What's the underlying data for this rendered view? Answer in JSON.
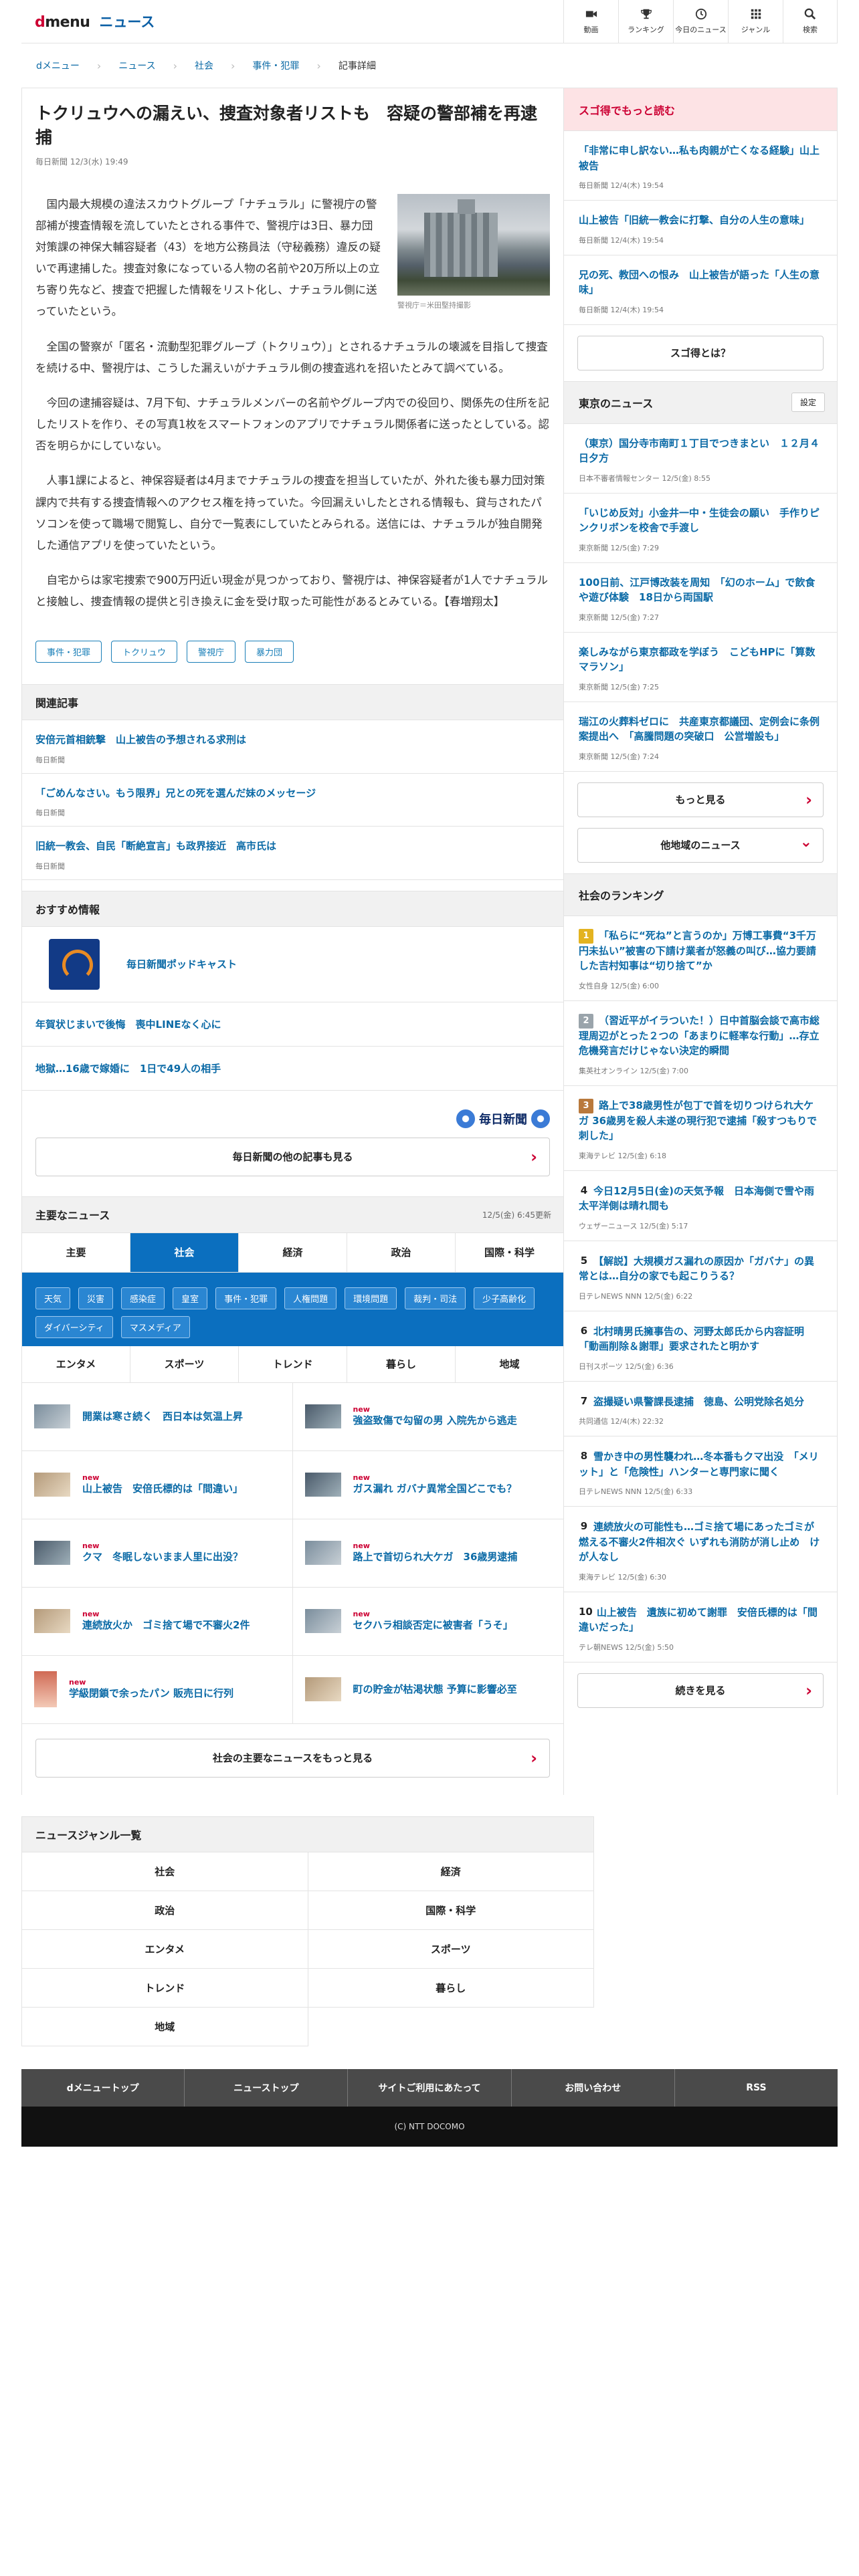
{
  "header": {
    "logo_d": "d",
    "logo_menu": "menu",
    "logo_news": "ニュース",
    "nav": [
      {
        "label": "動画",
        "icon": "video-icon"
      },
      {
        "label": "ランキング",
        "icon": "trophy-icon"
      },
      {
        "label": "今日のニュース",
        "icon": "clock-icon"
      },
      {
        "label": "ジャンル",
        "icon": "grid-icon"
      },
      {
        "label": "検索",
        "icon": "search-icon"
      }
    ]
  },
  "breadcrumb": [
    "dメニュー",
    "ニュース",
    "社会",
    "事件・犯罪",
    "記事詳細"
  ],
  "article": {
    "title": "トクリュウへの漏えい、捜査対象者リストも　容疑の警部補を再逮捕",
    "meta": "毎日新聞 12/3(水) 19:49",
    "image_caption": "警視庁＝米田堅持撮影",
    "paragraphs": [
      "国内最大規模の違法スカウトグループ「ナチュラル」に警視庁の警部補が捜査情報を流していたとされる事件で、警視庁は3日、暴力団対策課の神保大輔容疑者（43）を地方公務員法（守秘義務）違反の疑いで再逮捕した。捜査対象になっている人物の名前や20万所以上の立ち寄り先など、捜査で把握した情報をリスト化し、ナチュラル側に送っていたという。",
      "全国の警察が「匿名・流動型犯罪グループ（トクリュウ）」とされるナチュラルの壊滅を目指して捜査を続ける中、警視庁は、こうした漏えいがナチュラル側の捜査逃れを招いたとみて調べている。",
      "今回の逮捕容疑は、7月下旬、ナチュラルメンバーの名前やグループ内での役回り、関係先の住所を記したリストを作り、その写真1枚をスマートフォンのアプリでナチュラル関係者に送ったとしている。認否を明らかにしていない。",
      "人事1課によると、神保容疑者は4月までナチュラルの捜査を担当していたが、外れた後も暴力団対策課内で共有する捜査情報へのアクセス権を持っていた。今回漏えいしたとされる情報も、貸与されたパソコンを使って職場で閲覧し、自分で一覧表にしていたとみられる。送信には、ナチュラルが独自開発した通信アプリを使っていたという。",
      "自宅からは家宅捜索で900万円近い現金が見つかっており、警視庁は、神保容疑者が1人でナチュラルと接触し、捜査情報の提供と引き換えに金を受け取った可能性があるとみている。【春増翔太】"
    ],
    "tags": [
      "事件・犯罪",
      "トクリュウ",
      "警視庁",
      "暴力団"
    ]
  },
  "related": {
    "heading": "関連記事",
    "items": [
      {
        "title": "安倍元首相銃撃　山上被告の予想される求刑は",
        "source": "毎日新聞"
      },
      {
        "title": "「ごめんなさい。もう限界」兄との死を選んだ妹のメッセージ",
        "source": "毎日新聞"
      },
      {
        "title": "旧統一教会、自民「断絶宣言」も政界接近　高市氏は",
        "source": "毎日新聞"
      }
    ]
  },
  "recommended": {
    "heading": "おすすめ情報",
    "podcast": "毎日新聞ポッドキャスト",
    "links": [
      "年賀状じまいで後悔　喪中LINEなく心に",
      "地獄…16歳で嫁婚に　1日で49人の相手"
    ],
    "publisher_logo": "毎日新聞",
    "more_button": "毎日新聞の他の記事も見る"
  },
  "major_news": {
    "heading": "主要なニュース",
    "updated": "12/5(金) 6:45更新",
    "tabs": [
      "主要",
      "社会",
      "経済",
      "政治",
      "国際・科学"
    ],
    "active_tab": "社会",
    "subcategories": [
      "天気",
      "災害",
      "感染症",
      "皇室",
      "事件・犯罪",
      "人権問題",
      "環境問題",
      "裁判・司法",
      "少子高齢化",
      "ダイバーシティ",
      "マスメディア"
    ],
    "tabs2": [
      "エンタメ",
      "スポーツ",
      "トレンド",
      "暮らし",
      "地域"
    ],
    "items": [
      {
        "title": "開業は寒さ続く　西日本は気温上昇",
        "new": ""
      },
      {
        "title": "強盗致傷で勾留の男 入院先から逃走",
        "new": "new"
      },
      {
        "title": "山上被告　安倍氏標的は「間違い」",
        "new": "new"
      },
      {
        "title": "ガス漏れ ガバナ異常全国どこでも？",
        "new": "new"
      },
      {
        "title": "クマ　冬眠しないまま人里に出没？",
        "new": "new"
      },
      {
        "title": "路上で首切られ大ケガ　36歳男逮捕",
        "new": "new"
      },
      {
        "title": "連続放火か　ゴミ捨て場で不審火2件",
        "new": "new"
      },
      {
        "title": "セクハラ相談否定に被害者「うそ」",
        "new": "new"
      },
      {
        "title": "学級閉鎖で余ったパン 販売日に行列",
        "new": "new"
      },
      {
        "title": "町の貯金が枯渇状態 予算に影響必至",
        "new": ""
      }
    ],
    "more_button": "社会の主要なニュースをもっと見る"
  },
  "sidebar": {
    "sugotoku": {
      "heading": "スゴ得でもっと読む",
      "items": [
        {
          "title": "「非常に申し訳ない…私も肉親が亡くなる経験」山上被告",
          "source": "毎日新聞 12/4(木) 19:54"
        },
        {
          "title": "山上被告「旧統一教会に打撃、自分の人生の意味」",
          "source": "毎日新聞 12/4(木) 19:54"
        },
        {
          "title": "兄の死、教団への恨み　山上被告が語った「人生の意味」",
          "source": "毎日新聞 12/4(木) 19:54"
        }
      ],
      "button": "スゴ得とは？"
    },
    "tokyo": {
      "heading": "東京のニュース",
      "setting": "設定",
      "items": [
        {
          "title": "（東京）国分寺市南町１丁目でつきまとい　１２月４日夕方",
          "source": "日本不審者情報センター 12/5(金) 8:55"
        },
        {
          "title": "「いじめ反対」小金井一中・生徒会の願い　手作りピンクリボンを校舎で手渡し",
          "source": "東京新聞 12/5(金) 7:29"
        },
        {
          "title": "100日前、江戸博改装を周知　「幻のホーム」で飲食や遊び体験　18日から両国駅",
          "source": "東京新聞 12/5(金) 7:27"
        },
        {
          "title": "楽しみながら東京都政を学ぼう　こどもHPに「算数マラソン」",
          "source": "東京新聞 12/5(金) 7:25"
        },
        {
          "title": "瑞江の火葬料ゼロに　共産東京都議団、定例会に条例案提出へ　「高騰問題の突破口　公営増設も」",
          "source": "東京新聞 12/5(金) 7:24"
        }
      ],
      "more_button": "もっと見る",
      "other_button": "他地域のニュース"
    },
    "ranking": {
      "heading": "社会のランキング",
      "items": [
        {
          "rank": "1",
          "title": "「私らに“死ね”と言うのか」万博工事費“3千万円未払い”被害の下請け業者が怒義の叫び…協力要請した吉村知事は“切り捨て”か",
          "source": "女性自身 12/5(金) 6:00"
        },
        {
          "rank": "2",
          "title": "（習近平がイラついた！）日中首脳会談で高市総理周辺がとった２つの「あまりに軽率な行動」…存立危機発言だけじゃない決定的瞬間",
          "source": "集英社オンライン 12/5(金) 7:00"
        },
        {
          "rank": "3",
          "title": "路上で38歳男性が包丁で首を切りつけられ大ケガ 36歳男を殺人未遂の現行犯で逮捕「殺すつもりで刺した」",
          "source": "東海テレビ 12/5(金) 6:18"
        },
        {
          "rank": "4",
          "title": "今日12月5日(金)の天気予報　日本海側で雪や雨　太平洋側は晴れ間も",
          "source": "ウェザーニュース 12/5(金) 5:17"
        },
        {
          "rank": "5",
          "title": "【解説】大規模ガス漏れの原因か「ガバナ」の異常とは…自分の家でも起こりうる？",
          "source": "日テレNEWS NNN 12/5(金) 6:22"
        },
        {
          "rank": "6",
          "title": "北村晴男氏擁事告の、河野太郎氏から内容証明「動画削除＆謝罪」要求されたと明かす",
          "source": "日刊スポーツ 12/5(金) 6:36"
        },
        {
          "rank": "7",
          "title": "盗撮疑い県警課長逮捕　徳島、公明党除名処分",
          "source": "共同通信 12/4(木) 22:32"
        },
        {
          "rank": "8",
          "title": "雪かき中の男性襲われ…冬本番もクマ出没　「メリット」と「危険性」ハンターと専門家に聞く",
          "source": "日テレNEWS NNN 12/5(金) 6:33"
        },
        {
          "rank": "9",
          "title": "連続放火の可能性も…ゴミ捨て場にあったゴミが燃える不審火2件相次ぐ いずれも消防が消し止め　けが人なし",
          "source": "東海テレビ 12/5(金) 6:30"
        },
        {
          "rank": "10",
          "title": "山上被告　遺族に初めて謝罪　安倍氏標的は「間違いだった」",
          "source": "テレ朝NEWS 12/5(金) 5:50"
        }
      ],
      "more_button": "続きを見る"
    }
  },
  "genre_list": {
    "heading": "ニュースジャンル一覧",
    "items": [
      "社会",
      "経済",
      "政治",
      "国際・科学",
      "エンタメ",
      "スポーツ",
      "トレンド",
      "暮らし",
      "地域"
    ]
  },
  "footer": {
    "nav": [
      "dメニュートップ",
      "ニューストップ",
      "サイトご利用にあたって",
      "お問い合わせ",
      "RSS"
    ],
    "copyright": "(C) NTT DOCOMO"
  },
  "colors": {
    "brand": "#cc0033",
    "link": "#0b6aa6",
    "active_tab": "#0b6fbf"
  }
}
